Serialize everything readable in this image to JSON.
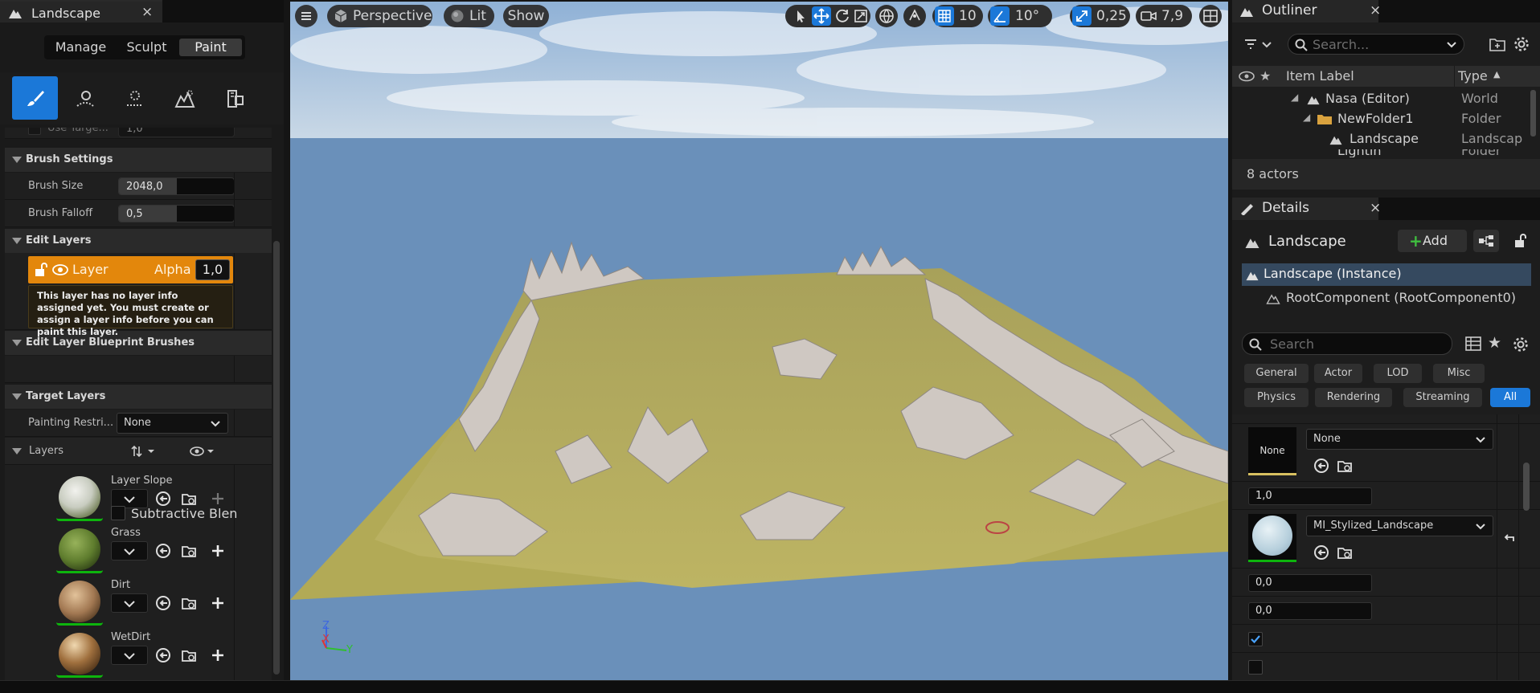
{
  "left": {
    "tab_title": "Landscape",
    "tab_close": "×",
    "modes": [
      "Manage",
      "Sculpt",
      "Paint"
    ],
    "active_mode": "Paint",
    "tools": [
      {
        "icon": "paint-brush-icon",
        "active": true
      },
      {
        "icon": "smooth-tool-icon",
        "active": false
      },
      {
        "icon": "flatten-tool-icon",
        "active": false
      },
      {
        "icon": "noise-tool-icon",
        "active": false
      },
      {
        "icon": "retopologize-tool-icon",
        "active": false
      }
    ],
    "clipped_row": {
      "label": "Use Targe...",
      "value": "1,0"
    },
    "brush_settings": {
      "title": "Brush Settings",
      "size_label": "Brush Size",
      "size_value": "2048,0",
      "size_fraction": 0.5,
      "falloff_label": "Brush Falloff",
      "falloff_value": "0,5",
      "falloff_fraction": 0.5
    },
    "edit_layers": {
      "title": "Edit Layers",
      "layer_name": "Layer",
      "alpha_label": "Alpha",
      "alpha_value": "1,0",
      "warning": "This layer has no layer info assigned yet. You must create or assign a layer info before you can paint this layer."
    },
    "blueprint_brushes": {
      "title": "Edit Layer Blueprint Brushes"
    },
    "target_layers": {
      "title": "Target Layers",
      "painting_label": "Painting Restri...",
      "painting_value": "None"
    },
    "layers": {
      "title": "Layers",
      "items": [
        {
          "name": "Layer Slope",
          "extra": "Subtractive Blen"
        },
        {
          "name": "Grass"
        },
        {
          "name": "Dirt"
        },
        {
          "name": "WetDirt"
        }
      ]
    }
  },
  "viewport": {
    "view_mode": "Perspective",
    "lighting": "Lit",
    "show": "Show",
    "grid_snap": "10",
    "rot_snap": "10°",
    "scale_snap": "0,25",
    "cam_speed": "7,9",
    "axis_z": "Z",
    "axis_x": "X",
    "axis_y": "Y",
    "colors": {
      "sky": "#6a90ba",
      "ground": "#b2aa56",
      "rock": "#cfc8c2"
    }
  },
  "outliner": {
    "tab_title": "Outliner",
    "tab_close": "×",
    "search_placeholder": "Search...",
    "col_label": "Item Label",
    "col_type": "Type",
    "rows": [
      {
        "label": "Nasa (Editor)",
        "type": "World"
      },
      {
        "label": "NewFolder1",
        "type": "Folder"
      },
      {
        "label": "Landscape",
        "type": "Landscap"
      },
      {
        "label": "Lightin",
        "type": "Folder"
      }
    ],
    "status": "8 actors"
  },
  "details": {
    "tab_title": "Details",
    "tab_close": "×",
    "object_name": "Landscape",
    "add_label": "Add",
    "instance": "Landscape (Instance)",
    "root_component": "RootComponent (RootComponent0)",
    "search_placeholder": "Search",
    "filters_row1": [
      "General",
      "Actor",
      "LOD",
      "Misc"
    ],
    "filters_row2": [
      "Physics",
      "Rendering",
      "Streaming",
      "All"
    ],
    "active_filter": "All",
    "mat1_thumb": "None",
    "mat1_select": "None",
    "value1": "1,0",
    "mat2_select": "MI_Stylized_Landscape",
    "value2": "0,0",
    "value3": "0,0",
    "check1": true,
    "check2": false
  }
}
